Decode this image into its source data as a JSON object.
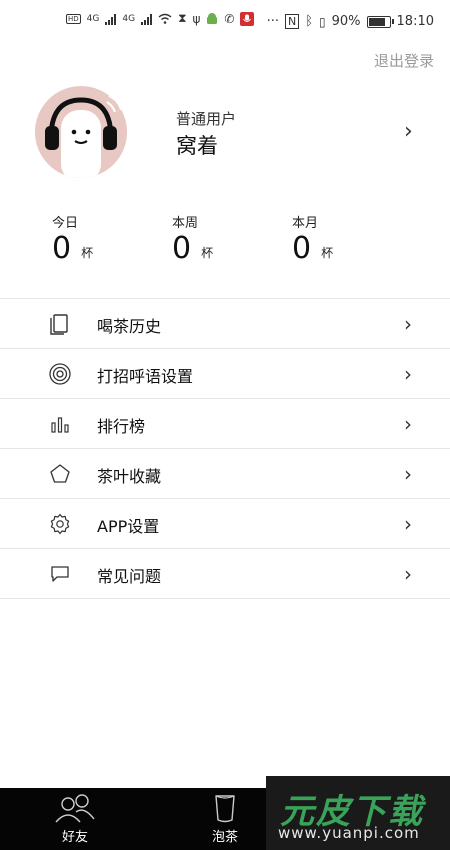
{
  "status_bar": {
    "network_left": [
      "HD",
      "HD",
      "4G",
      "4G"
    ],
    "dots": "···",
    "battery_percent": "90%",
    "battery_level": 0.9,
    "time": "18:10"
  },
  "header": {
    "logout_label": "退出登录"
  },
  "profile": {
    "user_type": "普通用户",
    "username": "窝着"
  },
  "stats": [
    {
      "label": "今日",
      "value": "0",
      "unit": "杯"
    },
    {
      "label": "本周",
      "value": "0",
      "unit": "杯"
    },
    {
      "label": "本月",
      "value": "0",
      "unit": "杯"
    }
  ],
  "menu": [
    {
      "label": "喝茶历史",
      "icon": "document-icon"
    },
    {
      "label": "打招呼语设置",
      "icon": "target-icon"
    },
    {
      "label": "排行榜",
      "icon": "bar-chart-icon"
    },
    {
      "label": "茶叶收藏",
      "icon": "pentagon-icon"
    },
    {
      "label": "APP设置",
      "icon": "gear-icon"
    },
    {
      "label": "常见问题",
      "icon": "chat-bubble-icon"
    }
  ],
  "tabbar": [
    {
      "label": "好友",
      "icon": "friends-icon"
    },
    {
      "label": "泡茶",
      "icon": "cup-icon"
    }
  ],
  "watermark": {
    "title": "元皮下载",
    "url": "www.yuanpi.com"
  },
  "colors": {
    "tab_bar_bg": "#050505",
    "avatar_bg": "#e8c8c3",
    "watermark_green": "#3aa35a"
  }
}
